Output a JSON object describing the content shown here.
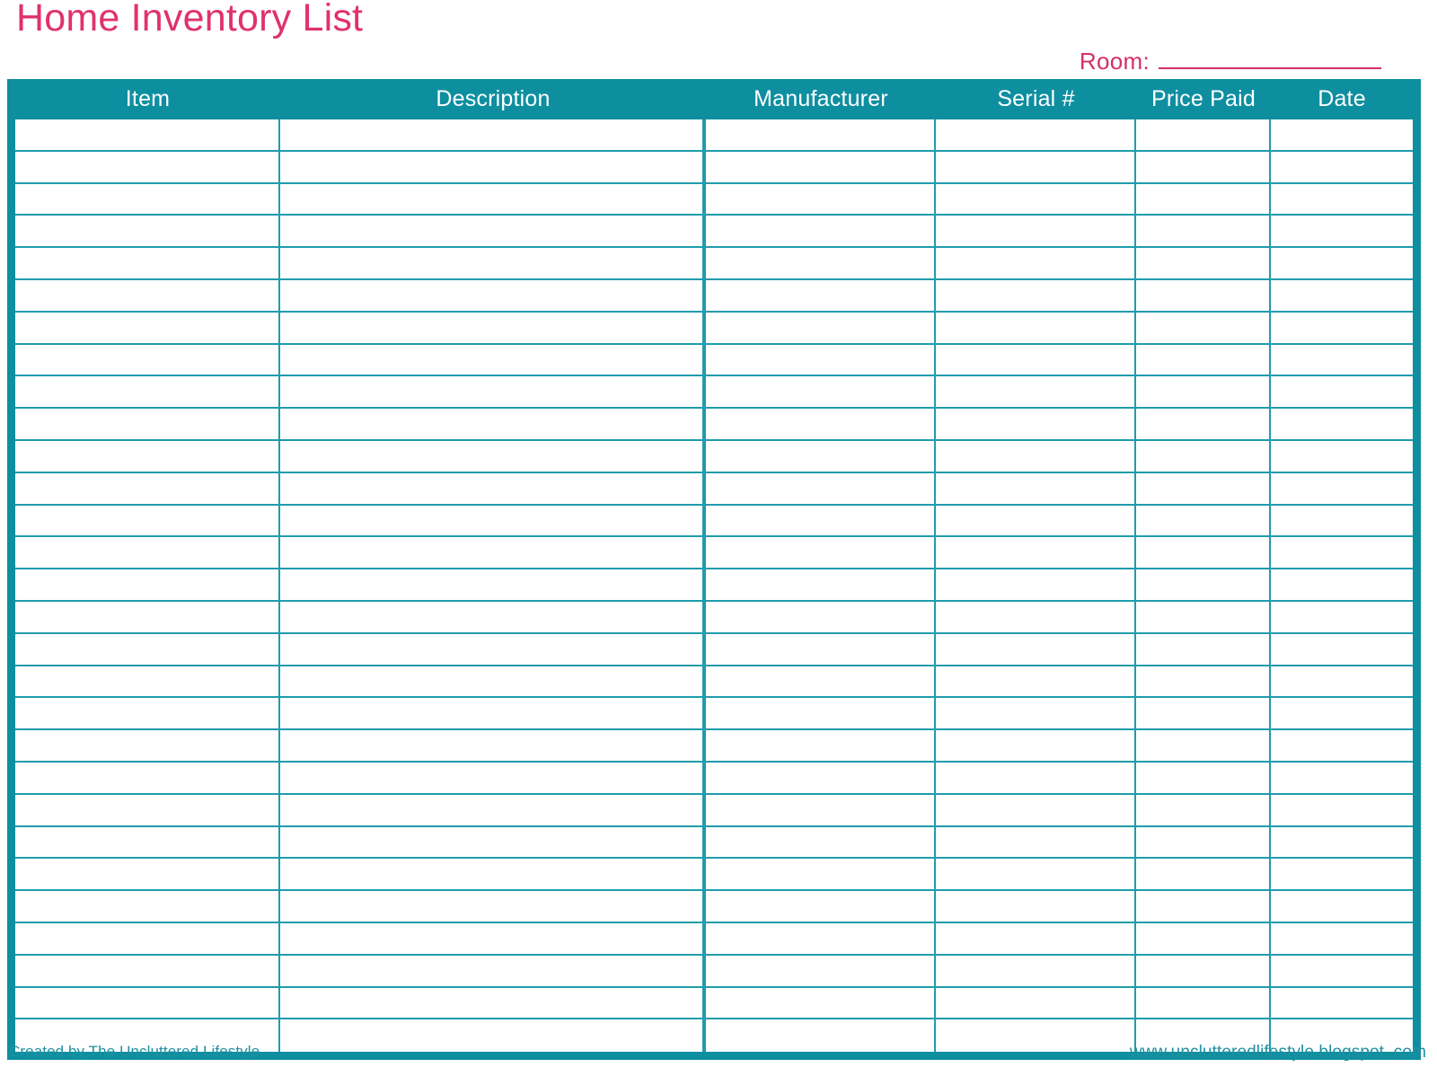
{
  "document": {
    "title": "Home Inventory List",
    "accent_pink": "#e0326a",
    "accent_teal": "#0e8fa0",
    "grid_line_color": "#1f9cac"
  },
  "room_field": {
    "label": "Room:",
    "value": "",
    "placeholder": ""
  },
  "table": {
    "columns": [
      {
        "key": "item",
        "label": "Item"
      },
      {
        "key": "description",
        "label": "Description"
      },
      {
        "key": "manufacturer",
        "label": "Manufacturer"
      },
      {
        "key": "serial",
        "label": "Serial #"
      },
      {
        "key": "price_paid",
        "label": "Price Paid"
      },
      {
        "key": "date",
        "label": "Date"
      }
    ],
    "row_count": 29,
    "rows": [
      {
        "item": "",
        "description": "",
        "manufacturer": "",
        "serial": "",
        "price_paid": "",
        "date": ""
      },
      {
        "item": "",
        "description": "",
        "manufacturer": "",
        "serial": "",
        "price_paid": "",
        "date": ""
      },
      {
        "item": "",
        "description": "",
        "manufacturer": "",
        "serial": "",
        "price_paid": "",
        "date": ""
      },
      {
        "item": "",
        "description": "",
        "manufacturer": "",
        "serial": "",
        "price_paid": "",
        "date": ""
      },
      {
        "item": "",
        "description": "",
        "manufacturer": "",
        "serial": "",
        "price_paid": "",
        "date": ""
      },
      {
        "item": "",
        "description": "",
        "manufacturer": "",
        "serial": "",
        "price_paid": "",
        "date": ""
      },
      {
        "item": "",
        "description": "",
        "manufacturer": "",
        "serial": "",
        "price_paid": "",
        "date": ""
      },
      {
        "item": "",
        "description": "",
        "manufacturer": "",
        "serial": "",
        "price_paid": "",
        "date": ""
      },
      {
        "item": "",
        "description": "",
        "manufacturer": "",
        "serial": "",
        "price_paid": "",
        "date": ""
      },
      {
        "item": "",
        "description": "",
        "manufacturer": "",
        "serial": "",
        "price_paid": "",
        "date": ""
      },
      {
        "item": "",
        "description": "",
        "manufacturer": "",
        "serial": "",
        "price_paid": "",
        "date": ""
      },
      {
        "item": "",
        "description": "",
        "manufacturer": "",
        "serial": "",
        "price_paid": "",
        "date": ""
      },
      {
        "item": "",
        "description": "",
        "manufacturer": "",
        "serial": "",
        "price_paid": "",
        "date": ""
      },
      {
        "item": "",
        "description": "",
        "manufacturer": "",
        "serial": "",
        "price_paid": "",
        "date": ""
      },
      {
        "item": "",
        "description": "",
        "manufacturer": "",
        "serial": "",
        "price_paid": "",
        "date": ""
      },
      {
        "item": "",
        "description": "",
        "manufacturer": "",
        "serial": "",
        "price_paid": "",
        "date": ""
      },
      {
        "item": "",
        "description": "",
        "manufacturer": "",
        "serial": "",
        "price_paid": "",
        "date": ""
      },
      {
        "item": "",
        "description": "",
        "manufacturer": "",
        "serial": "",
        "price_paid": "",
        "date": ""
      },
      {
        "item": "",
        "description": "",
        "manufacturer": "",
        "serial": "",
        "price_paid": "",
        "date": ""
      },
      {
        "item": "",
        "description": "",
        "manufacturer": "",
        "serial": "",
        "price_paid": "",
        "date": ""
      },
      {
        "item": "",
        "description": "",
        "manufacturer": "",
        "serial": "",
        "price_paid": "",
        "date": ""
      },
      {
        "item": "",
        "description": "",
        "manufacturer": "",
        "serial": "",
        "price_paid": "",
        "date": ""
      },
      {
        "item": "",
        "description": "",
        "manufacturer": "",
        "serial": "",
        "price_paid": "",
        "date": ""
      },
      {
        "item": "",
        "description": "",
        "manufacturer": "",
        "serial": "",
        "price_paid": "",
        "date": ""
      },
      {
        "item": "",
        "description": "",
        "manufacturer": "",
        "serial": "",
        "price_paid": "",
        "date": ""
      },
      {
        "item": "",
        "description": "",
        "manufacturer": "",
        "serial": "",
        "price_paid": "",
        "date": ""
      },
      {
        "item": "",
        "description": "",
        "manufacturer": "",
        "serial": "",
        "price_paid": "",
        "date": ""
      },
      {
        "item": "",
        "description": "",
        "manufacturer": "",
        "serial": "",
        "price_paid": "",
        "date": ""
      },
      {
        "item": "",
        "description": "",
        "manufacturer": "",
        "serial": "",
        "price_paid": "",
        "date": ""
      }
    ]
  },
  "footer": {
    "credit": "Created by The Uncluttered Lifestyle",
    "website": "www.unclutteredlifestyle.blogspot .com"
  }
}
